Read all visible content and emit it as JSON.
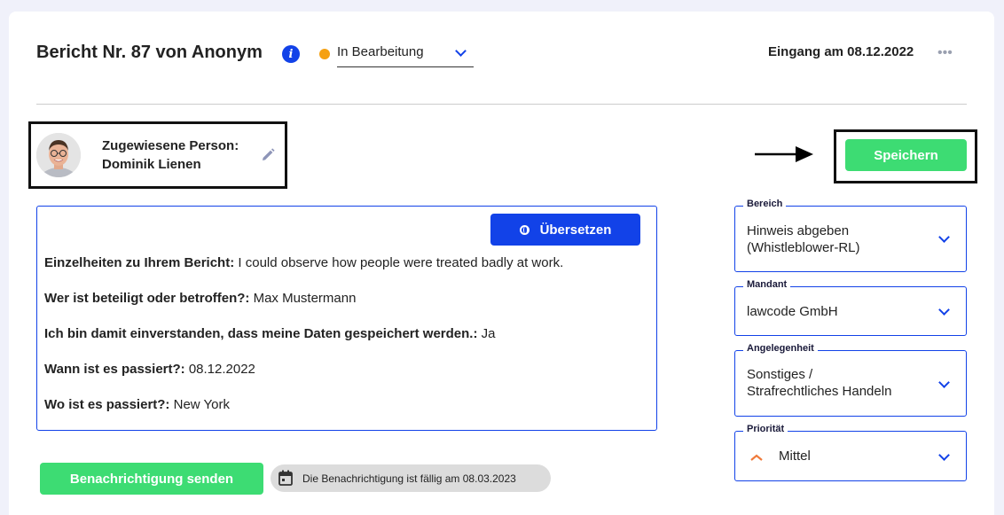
{
  "header": {
    "title": "Bericht Nr. 87 von Anonym",
    "status": "In Bearbeitung",
    "received": "Eingang am 08.12.2022",
    "more": "•••"
  },
  "assignee": {
    "label": "Zugewiesene Person:",
    "name": "Dominik Lienen"
  },
  "actions": {
    "save": "Speichern",
    "translate": "Übersetzen"
  },
  "details": [
    {
      "q": "Einzelheiten zu Ihrem Bericht:",
      "a": " I could observe how people were treated badly at work."
    },
    {
      "q": "Wer ist beteiligt oder betroffen?:",
      "a": " Max Mustermann"
    },
    {
      "q": "Ich bin damit einverstanden, dass meine Daten gespeichert werden.:",
      "a": " Ja"
    },
    {
      "q": "Wann ist es passiert?:",
      "a": " 08.12.2022"
    },
    {
      "q": "Wo ist es passiert?:",
      "a": " New York"
    }
  ],
  "fields": {
    "bereich": {
      "label": "Bereich",
      "line1": "Hinweis abgeben",
      "line2": "(Whistleblower-RL)"
    },
    "mandant": {
      "label": "Mandant",
      "value": "lawcode GmbH"
    },
    "angelegenheit": {
      "label": "Angelegenheit",
      "line1": "Sonstiges /",
      "line2": "Strafrechtliches Handeln"
    },
    "prioritaet": {
      "label": "Priorität",
      "value": "Mittel"
    }
  },
  "footer": {
    "notify": "Benachrichtigung senden",
    "due": "Die Benachrichtigung ist fällig am 08.03.2023"
  },
  "colors": {
    "accent": "#1242e8",
    "success": "#3ddc73",
    "status_dot": "#f5a011",
    "priority": "#f07a3a"
  }
}
